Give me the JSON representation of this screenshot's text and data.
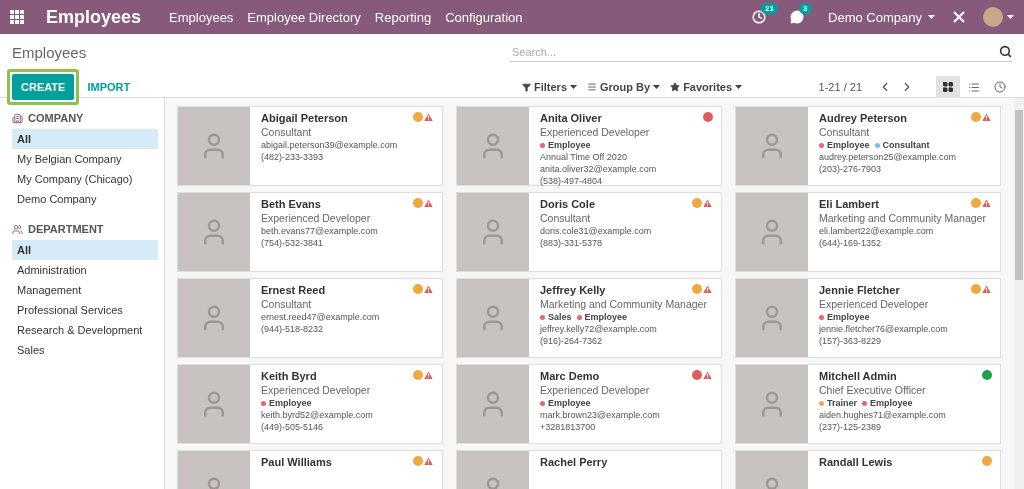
{
  "app_bar": {
    "app_name": "Employees",
    "menu": [
      "Employees",
      "Employee Directory",
      "Reporting",
      "Configuration"
    ],
    "activity_count": "21",
    "message_count": "3",
    "company": "Demo Company"
  },
  "control_panel": {
    "breadcrumb": "Employees",
    "search": {
      "placeholder": "Search..."
    },
    "buttons": [
      {
        "label": "CREATE",
        "kind": "primary",
        "highlighted": true
      },
      {
        "label": "IMPORT",
        "kind": "link",
        "highlighted": false
      }
    ],
    "filters": [
      {
        "label": "Filters",
        "kind": "filter"
      },
      {
        "label": "Group By",
        "kind": "group"
      },
      {
        "label": "Favorites",
        "kind": "favorite"
      }
    ],
    "pager": "1-21 / 21",
    "views": [
      {
        "kind": "kanban",
        "selected": true
      },
      {
        "kind": "list",
        "selected": false
      },
      {
        "kind": "activity",
        "selected": false
      }
    ]
  },
  "sidebar": {
    "sections": [
      {
        "kind": "company",
        "title": "COMPANY",
        "items": [
          {
            "label": "All",
            "selected": true
          },
          {
            "label": "My Belgian Company",
            "selected": false
          },
          {
            "label": "My Company (Chicago)",
            "selected": false
          },
          {
            "label": "Demo Company",
            "selected": false
          }
        ]
      },
      {
        "kind": "department",
        "title": "DEPARTMENT",
        "items": [
          {
            "label": "All",
            "selected": true
          },
          {
            "label": "Administration",
            "selected": false
          },
          {
            "label": "Management",
            "selected": false
          },
          {
            "label": "Professional Services",
            "selected": false
          },
          {
            "label": "Research & Development",
            "selected": false
          },
          {
            "label": "Sales",
            "selected": false
          }
        ]
      }
    ]
  },
  "employees": [
    {
      "name": "Abigail Peterson",
      "job": "Consultant",
      "email": "abigail.peterson39@example.com",
      "phone": "(482)-233-3393",
      "status": {
        "color": "#f0a941"
      },
      "warning": true
    },
    {
      "name": "Anita Oliver",
      "job": "Experienced Developer",
      "tags": [
        {
          "label": "Employee",
          "color": "#ec6464"
        }
      ],
      "note": "Annual Time Off 2020",
      "email": "anita.oliver32@example.com",
      "phone": "(538)-497-4804",
      "status": {
        "color": "#e05c5c"
      },
      "warning": false
    },
    {
      "name": "Audrey Peterson",
      "job": "Consultant",
      "tags": [
        {
          "label": "Employee",
          "color": "#ec6464"
        },
        {
          "label": "Consultant",
          "color": "#6cc1ed"
        }
      ],
      "email": "audrey.peterson25@example.com",
      "phone": "(203)-276-7903",
      "status": {
        "color": "#f0a941"
      },
      "warning": true
    },
    {
      "name": "Beth Evans",
      "job": "Experienced Developer",
      "email": "beth.evans77@example.com",
      "phone": "(754)-532-3841",
      "status": {
        "color": "#f0a941"
      },
      "warning": true
    },
    {
      "name": "Doris Cole",
      "job": "Consultant",
      "email": "doris.cole31@example.com",
      "phone": "(883)-331-5378",
      "status": {
        "color": "#f0a941"
      },
      "warning": true
    },
    {
      "name": "Eli Lambert",
      "job": "Marketing and Community Manager",
      "email": "eli.lambert22@example.com",
      "phone": "(644)-169-1352",
      "status": {
        "color": "#f0a941"
      },
      "warning": true
    },
    {
      "name": "Ernest Reed",
      "job": "Consultant",
      "email": "ernest.reed47@example.com",
      "phone": "(944)-518-8232",
      "status": {
        "color": "#f0a941"
      },
      "warning": true
    },
    {
      "name": "Jeffrey Kelly",
      "job": "Marketing and Community Manager",
      "tags": [
        {
          "label": "Sales",
          "color": "#ec6464"
        },
        {
          "label": "Employee",
          "color": "#ec6464"
        }
      ],
      "email": "jeffrey.kelly72@example.com",
      "phone": "(916)-264-7362",
      "status": {
        "color": "#f0a941"
      },
      "warning": true
    },
    {
      "name": "Jennie Fletcher",
      "job": "Experienced Developer",
      "tags": [
        {
          "label": "Employee",
          "color": "#ec6464"
        }
      ],
      "email": "jennie.fletcher76@example.com",
      "phone": "(157)-363-8229",
      "status": {
        "color": "#f0a941"
      },
      "warning": true
    },
    {
      "name": "Keith Byrd",
      "job": "Experienced Developer",
      "tags": [
        {
          "label": "Employee",
          "color": "#ec6464"
        }
      ],
      "email": "keith.byrd52@example.com",
      "phone": "(449)-505-5146",
      "status": {
        "color": "#f0a941"
      },
      "warning": true
    },
    {
      "name": "Marc Demo",
      "job": "Experienced Developer",
      "tags": [
        {
          "label": "Employee",
          "color": "#ec6464"
        }
      ],
      "email": "mark.brown23@example.com",
      "phone": "+3281813700",
      "status": {
        "color": "#e05c5c"
      },
      "warning": true
    },
    {
      "name": "Mitchell Admin",
      "job": "Chief Executive Officer",
      "tags": [
        {
          "label": "Trainer",
          "color": "#f4a460"
        },
        {
          "label": "Employee",
          "color": "#ec6464"
        }
      ],
      "email": "aiden.hughes71@example.com",
      "phone": "(237)-125-2389",
      "status": {
        "color": "#21a04b"
      },
      "warning": false
    },
    {
      "name": "Paul Williams",
      "status": {
        "color": "#f0a941"
      },
      "warning": true
    },
    {
      "name": "Rachel Perry",
      "warning": false
    },
    {
      "name": "Randall Lewis",
      "status": {
        "color": "#f0a941"
      },
      "warning": false
    }
  ]
}
